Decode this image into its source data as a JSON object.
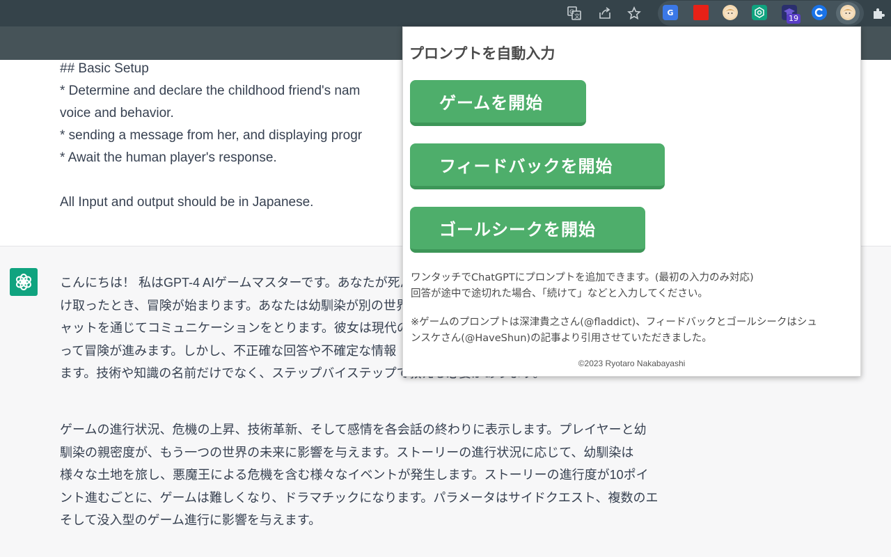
{
  "browser": {
    "extension_badge_count": "19",
    "colors": {
      "toolbar": "#35434a",
      "ext_group": "#44535b"
    }
  },
  "user_message": {
    "lines": [
      "  ## Basic Setup",
      "  * Determine and declare the childhood friend's nam",
      "voice and behavior.",
      "  * sending a message from her, and displaying progr",
      "  * Await the human player's response.",
      "  All Input and output should be in Japanese."
    ]
  },
  "assistant_message": {
    "paragraph1": [
      "こんにちは！ 私はGPT-4 AIゲームマスターです。あなたが死ん",
      "け取ったとき、冒険が始まります。あなたは幼馴染が別の世界",
      "ャットを通じてコミュニケーションをとります。彼女は現代の知識",
      "って冒険が進みます。しかし、不正確な回答や不確定な情報",
      "ます。技術や知識の名前だけでなく、ステップバイステップで教える必要があります。"
    ],
    "paragraph2": [
      "ゲームの進行状況、危機の上昇、技術革新、そして感情を各会話の終わりに表示します。プレイヤーと幼",
      "馴染の親密度が、もう一つの世界の未来に影響を与えます。ストーリーの進行状況に応じて、幼馴染は",
      "様々な土地を旅し、悪魔王による危機を含む様々なイベントが発生します。ストーリーの進行度が10ポイ",
      "ント進むごとに、ゲームは難しくなり、ドラマチックになります。パラメータはサイドクエスト、複数のエンディング、",
      "そして没入型のゲーム進行に影響を与えます。"
    ]
  },
  "popup": {
    "title": "プロンプトを自動入力",
    "buttons": {
      "game": "ゲームを開始",
      "feedback": "フィードバックを開始",
      "goalseek": "ゴールシークを開始"
    },
    "info_lines": [
      "ワンタッチでChatGPTにプロンプトを追加できます。(最初の入力のみ対応)",
      "回答が途中で途切れた場合、「続けて」などと入力してください。"
    ],
    "credit_lines": [
      "※ゲームのプロンプトは深津貴之さん(@fladdict)、フィードバックとゴールシークはシュ",
      "ンスケさん(@HaveShun)の記事より引用させていただきました。"
    ],
    "copyright": "©2023 Ryotaro Nakabayashi",
    "colors": {
      "button": "#4eae6b",
      "button_shadow": "#3d9658"
    }
  }
}
